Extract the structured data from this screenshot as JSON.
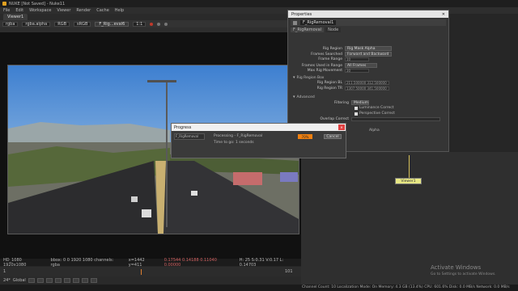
{
  "window": {
    "title": "NUKE [Not Saved] - Nuke11"
  },
  "menu": [
    "File",
    "Edit",
    "Workspace",
    "Viewer",
    "Render",
    "Cache",
    "Help"
  ],
  "viewer_tab": "Viewer1",
  "viewer_toolbar": {
    "channels": "rgba",
    "alpha": "rgba.alpha",
    "colorspace": "RGB",
    "lut": "sRGB",
    "node_a": "F_Rig...eval6",
    "zoom": "1:1"
  },
  "info_bar": {
    "format": "HD_1080 1920x1080",
    "bbox": "bbox: 0 0 1920 1080 channels: rgba",
    "coords": "x=1442 y=411",
    "color": "0.17544 0.14188 0.11040 0.00000",
    "hsv": "H: 25 S:0.31 V:0.17 L: 0.14703"
  },
  "timeline": {
    "frame": "1",
    "end": "101",
    "fps": "24*",
    "global": "Global"
  },
  "properties": {
    "panel_title": "Properties",
    "node_name": "F_RigRemoval1",
    "tab_node": "F_RigRemoval",
    "tab_node2": "Node",
    "fields": [
      {
        "label": "Rig Region",
        "value": "Rig Mask Alpha",
        "kind": "select"
      },
      {
        "label": "Frames Searched",
        "value": "Forward and Backward",
        "kind": "select"
      },
      {
        "label": "Frame Range",
        "value": "10",
        "kind": "input"
      },
      {
        "label": "Frames Used in Range",
        "value": "All Frames",
        "kind": "select"
      },
      {
        "label": "Max Rig Movement",
        "value": "30",
        "kind": "input"
      }
    ],
    "section_rigbox": "Rig Region Box",
    "rig_bl_label": "Rig Region BL",
    "rig_bl": "211.500000   312.500000",
    "rig_tr_label": "Rig Region TR",
    "rig_tr": "1307.50000   341.500000",
    "section_advanced": "Advanced",
    "filtering_label": "Filtering",
    "filtering_value": "Medium",
    "luminance": "Luminance Correct",
    "perspective": "Perspective Correct",
    "overlap_label": "Overlap Correct",
    "alpha_label": "Alpha"
  },
  "dialog": {
    "title": "Progress",
    "node": "F_RigRemoval",
    "processing": "Processing - F_RigRemoval",
    "time": "Time to go: 1 seconds",
    "progress_text": "70%",
    "progress": 0.7,
    "cancel": "Cancel"
  },
  "nodegraph": {
    "viewer_node": "Viewer1"
  },
  "watermark": {
    "title": "Activate Windows",
    "subtitle": "Go to Settings to activate Windows."
  },
  "status": "Channel Count: 10 Localization Mode: On Memory: 4.3 GB (13.4%) CPU: 601.6% Disk: 0.0 MB/s Network: 0.0 MB/s"
}
